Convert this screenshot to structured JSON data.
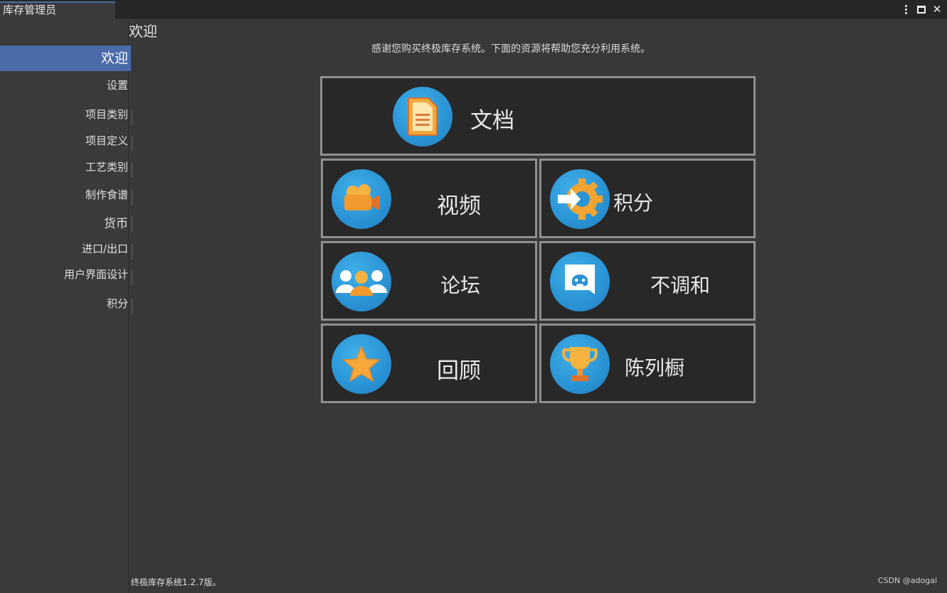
{
  "window": {
    "title": "库存管理员",
    "controls": {
      "menu_icon": "kebab-icon",
      "maximize_icon": "maximize-icon",
      "close_icon": "close-icon",
      "close_glyph": "✕"
    }
  },
  "sidebar": {
    "items": [
      {
        "label": "欢迎",
        "active": true
      },
      {
        "label": "设置"
      },
      {
        "label": "项目类别"
      },
      {
        "label": "项目定义"
      },
      {
        "label": "工艺类别"
      },
      {
        "label": "制作食谱"
      },
      {
        "label": "货币"
      },
      {
        "label": "进口/出口"
      },
      {
        "label": "用户界面设计"
      },
      {
        "label": "积分"
      }
    ]
  },
  "main": {
    "title": "欢迎",
    "intro": "感谢您购买终极库存系统。下面的资源将帮助您充分利用系统。",
    "tiles": [
      {
        "label": "文档",
        "icon": "document-icon"
      },
      {
        "label": "视频",
        "icon": "video-camera-icon"
      },
      {
        "label": "积分",
        "icon": "gear-arrow-icon"
      },
      {
        "label": "论坛",
        "icon": "users-icon"
      },
      {
        "label": "不调和",
        "icon": "discord-icon"
      },
      {
        "label": "回顾",
        "icon": "star-icon"
      },
      {
        "label": "陈列橱",
        "icon": "trophy-icon"
      }
    ]
  },
  "footer": {
    "version": "终极库存系统1.2.7版。",
    "watermark": "CSDN @adogai"
  },
  "colors": {
    "background": "#383838",
    "sidebar": "#3a3a3a",
    "active_accent": "#4a6aa8",
    "tile_border": "#8f8f8f",
    "icon_circle": "#2a93d4"
  }
}
